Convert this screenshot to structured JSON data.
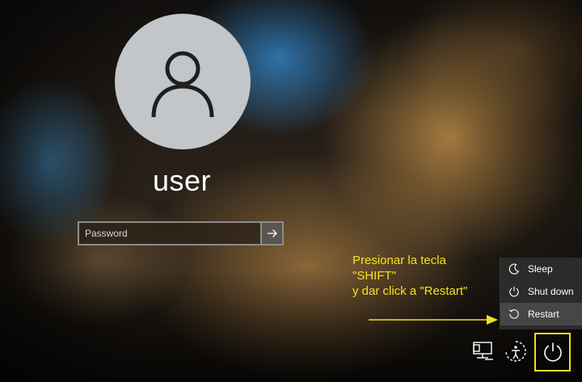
{
  "user": {
    "avatar_icon": "user-silhouette-icon",
    "name": "user"
  },
  "password": {
    "placeholder": "Password",
    "value": "",
    "submit_icon": "arrow-right-icon"
  },
  "annotation": {
    "lines": [
      "Presionar la tecla",
      "\"SHIFT\"",
      "y dar click a \"Restart\""
    ],
    "color": "#f2e21c"
  },
  "power_menu": {
    "items": [
      {
        "label": "Sleep",
        "icon": "moon-icon"
      },
      {
        "label": "Shut down",
        "icon": "power-icon"
      },
      {
        "label": "Restart",
        "icon": "restart-icon"
      }
    ],
    "highlighted": "Restart"
  },
  "system_buttons": [
    {
      "icon": "network-icon"
    },
    {
      "icon": "ease-of-access-icon"
    },
    {
      "icon": "power-icon"
    }
  ]
}
